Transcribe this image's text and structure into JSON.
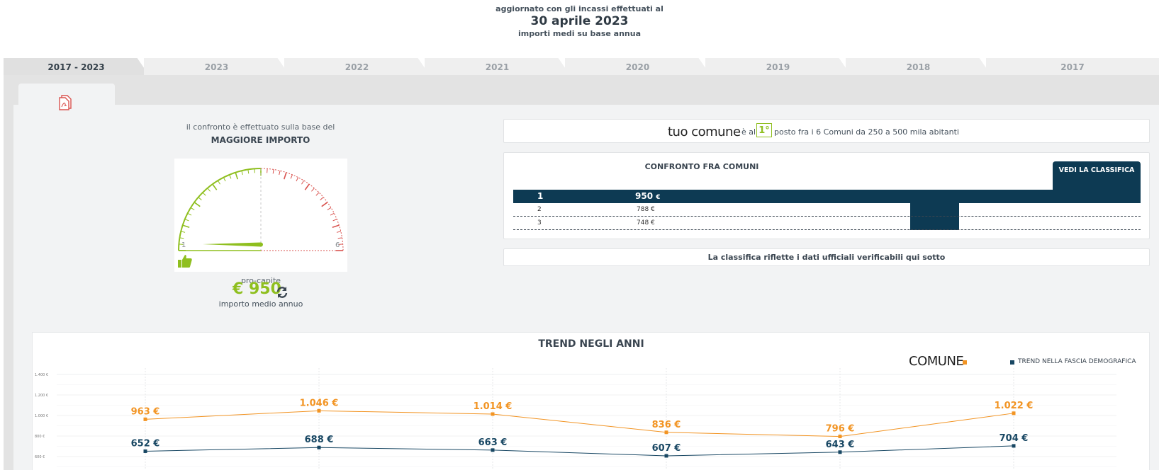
{
  "header": {
    "line1": "aggiornato con gli incassi effettuati al",
    "date": "30 aprile 2023",
    "line3": "importi medi su base annua"
  },
  "tabs": [
    {
      "label": "2017 - 2023",
      "active": true
    },
    {
      "label": "2023"
    },
    {
      "label": "2022"
    },
    {
      "label": "2021"
    },
    {
      "label": "2020"
    },
    {
      "label": "2019"
    },
    {
      "label": "2018"
    },
    {
      "label": "2017"
    }
  ],
  "toolbar": {
    "pdf_icon": "pdf-icon"
  },
  "gauge": {
    "intro": "il confronto è effettuato sulla base del",
    "title": "MAGGIORE IMPORTO",
    "min_label": "1",
    "max_label": "6",
    "value_position": 1,
    "per_capita_label": "pro-capite",
    "value": "€ 950",
    "subtitle": "importo medio annuo",
    "accent_color": "#8fbf1f",
    "danger_color": "#d9534f"
  },
  "ranking": {
    "name": "tuo comune",
    "pre": "è al",
    "position": "1°",
    "post": "posto fra i 6 Comuni da 250 a 500 mila abitanti"
  },
  "comparison": {
    "title": "CONFRONTO FRA COMUNI",
    "button": "VEDI LA CLASSIFICA",
    "rows": [
      {
        "pos": "1",
        "value": "950",
        "unit": "€"
      },
      {
        "pos": "2",
        "value": "788 €"
      },
      {
        "pos": "3",
        "value": "748 €"
      }
    ]
  },
  "note": "La classifica riflette i dati ufficiali verificabili qui sotto",
  "trend": {
    "title": "TREND NEGLI ANNI",
    "legend_comune": "COMUNE",
    "legend_trend": "TREND NELLA FASCIA DEMOGRAFICA"
  },
  "chart_data": {
    "type": "line",
    "title": "TREND NEGLI ANNI",
    "y_ticks": [
      "1.400 €",
      "1.200 €",
      "1.000 €",
      "800 €",
      "600 €"
    ],
    "ylim": [
      500,
      1400
    ],
    "series": [
      {
        "name": "COMUNE",
        "color": "#f29423",
        "values": [
          963,
          1046,
          1014,
          836,
          796,
          1022
        ],
        "labels": [
          "963 €",
          "1.046 €",
          "1.014 €",
          "836 €",
          "796 €",
          "1.022 €"
        ]
      },
      {
        "name": "TREND NELLA FASCIA DEMOGRAFICA",
        "color": "#184763",
        "values": [
          652,
          688,
          663,
          607,
          643,
          704
        ],
        "labels": [
          "652 €",
          "688 €",
          "663 €",
          "607 €",
          "643 €",
          "704 €"
        ]
      }
    ]
  }
}
